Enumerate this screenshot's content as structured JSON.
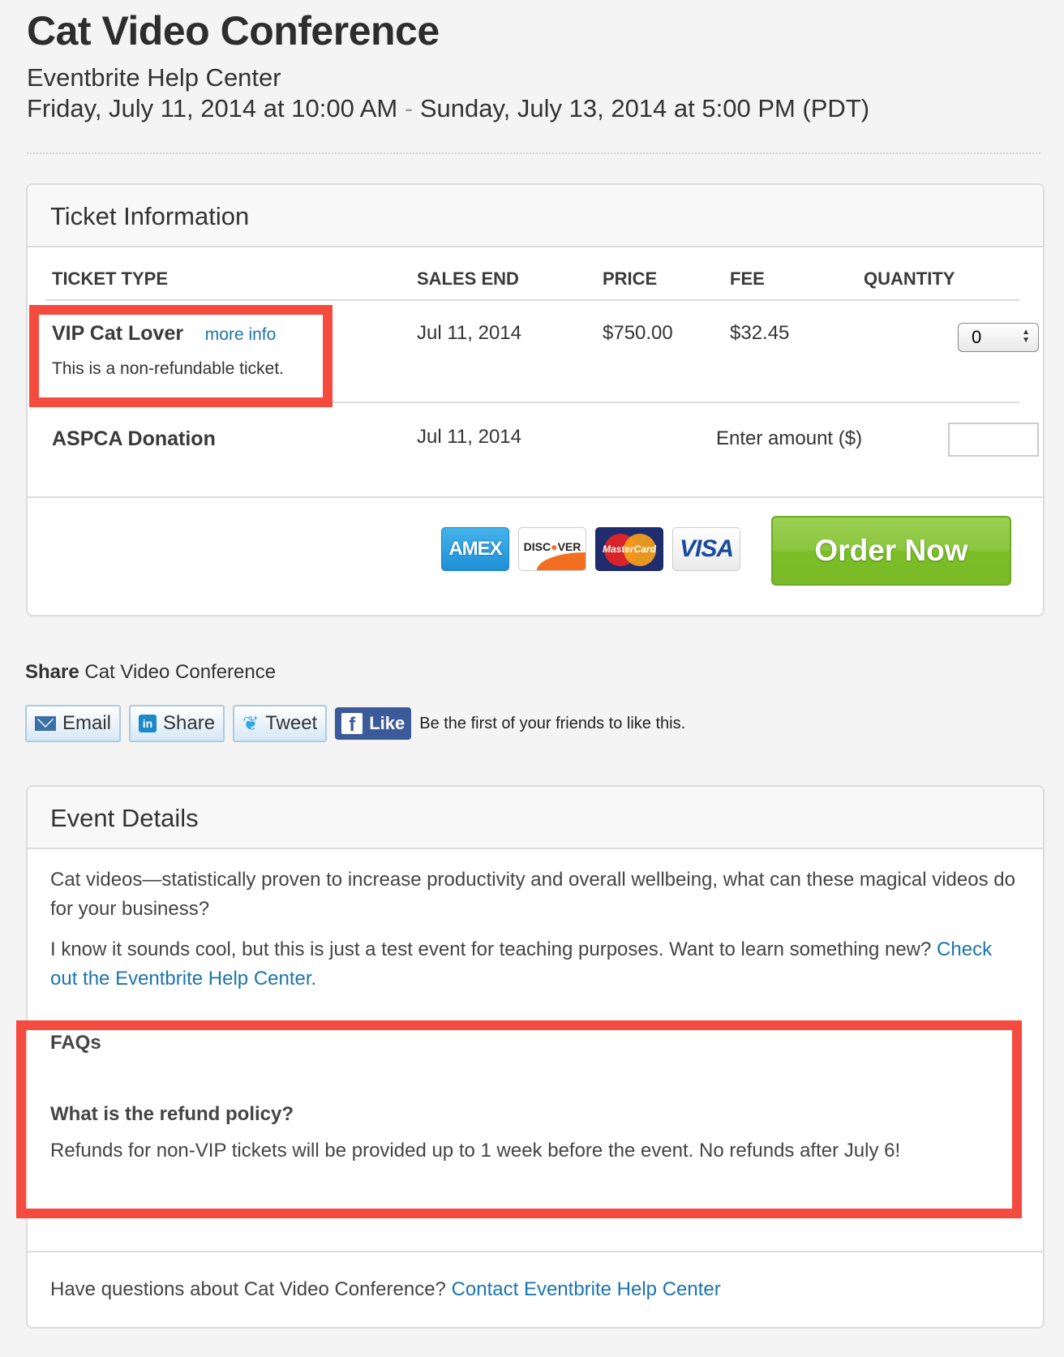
{
  "event": {
    "title": "Cat Video Conference",
    "organizer": "Eventbrite Help Center",
    "start": "Friday, July 11, 2014 at 10:00 AM",
    "separator": "-",
    "end": "Sunday, July 13, 2014 at 5:00 PM (PDT)"
  },
  "ticket_info": {
    "title": "Ticket Information",
    "columns": [
      "TICKET TYPE",
      "SALES END",
      "PRICE",
      "FEE",
      "QUANTITY"
    ],
    "tickets": [
      {
        "name": "VIP Cat Lover",
        "more_info": "more info",
        "description": "This is a non-refundable ticket.",
        "sales_end": "Jul 11, 2014",
        "price": "$750.00",
        "fee": "$32.45",
        "quantity": "0"
      }
    ],
    "donation": {
      "name": "ASPCA Donation",
      "sales_end": "Jul 11, 2014",
      "amount_label": "Enter amount ($)",
      "amount_value": ""
    },
    "cards": {
      "amex": "AMEX",
      "discover_pre": "DISC",
      "discover_dot": "●",
      "discover_post": "VER",
      "mastercard": "MasterCard",
      "visa": "VISA"
    },
    "order_button": "Order Now"
  },
  "share": {
    "label_bold": "Share",
    "label_rest": "Cat Video Conference",
    "buttons": {
      "email": "Email",
      "linkedin": "Share",
      "twitter": "Tweet",
      "facebook": "Like",
      "linkedin_glyph": "in",
      "facebook_glyph": "f",
      "twitter_glyph": "🐦"
    },
    "facebook_text": "Be the first of your friends to like this."
  },
  "event_details": {
    "title": "Event Details",
    "paragraph1": "Cat videos—statistically proven to increase productivity and overall wellbeing, what can these magical videos do for your business?",
    "paragraph2_text": "I know it sounds cool, but this is just a test event for teaching purposes. Want to learn something new?",
    "paragraph2_link": "Check out the Eventbrite Help Center.",
    "faq": {
      "title": "FAQs",
      "question": "What is the refund policy?",
      "answer": "Refunds for non-VIP tickets will be provided up to 1 week before the event. No refunds after July 6!"
    },
    "contact_text": "Have questions about Cat Video Conference?",
    "contact_link": "Contact Eventbrite Help Center"
  },
  "colors": {
    "highlight": "#f44b3e",
    "link": "#1a75ae",
    "order_button": "#8cc63f",
    "facebook": "#3b5a9a"
  }
}
